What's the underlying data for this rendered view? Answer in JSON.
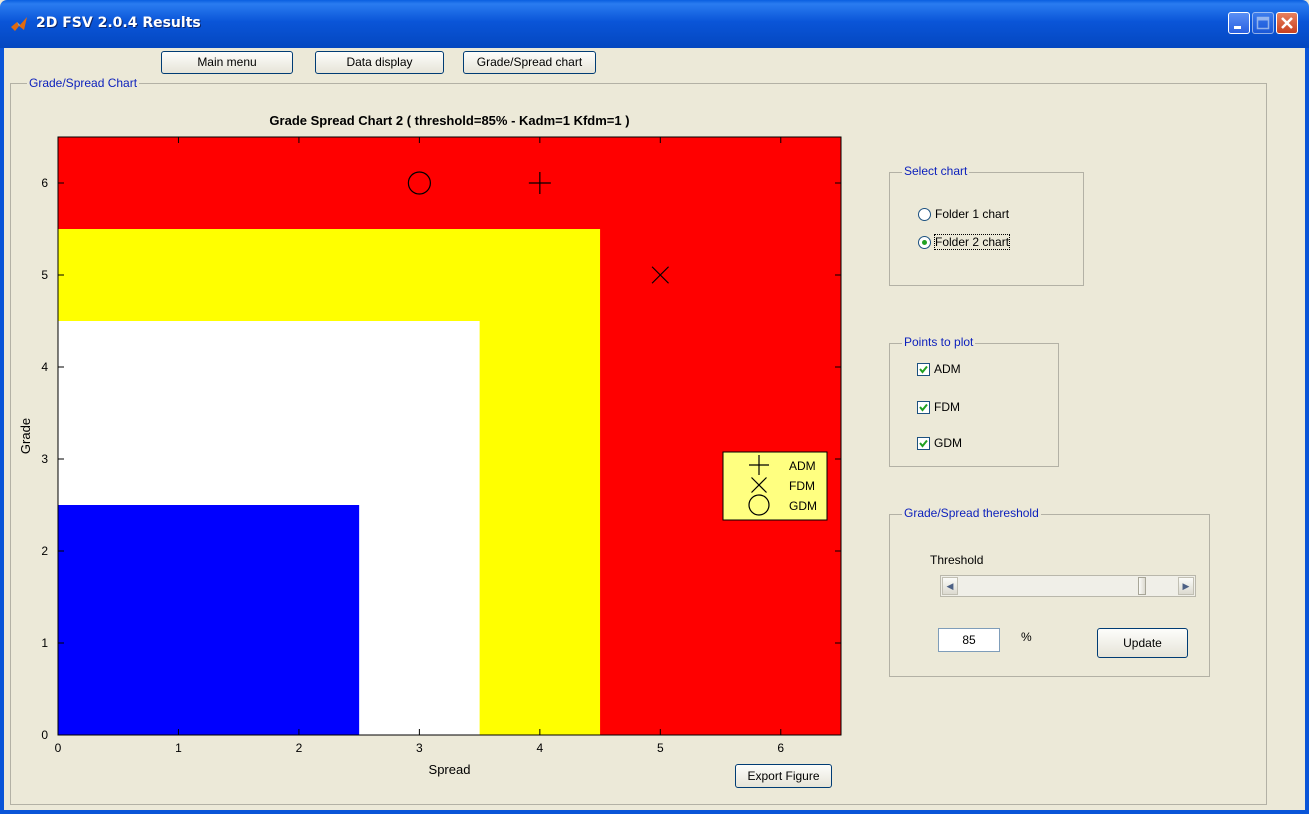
{
  "window": {
    "title": "2D FSV 2.0.4 Results",
    "icon": "matlab-logo-icon"
  },
  "toolbar": {
    "main_menu": "Main menu",
    "data_display": "Data display",
    "grade_spread_chart": "Grade/Spread chart"
  },
  "panel": {
    "title": "Grade/Spread Chart"
  },
  "chart_data": {
    "type": "scatter",
    "title": "Grade Spread Chart 2 ( threshold=85% - Kadm=1  Kfdm=1 )",
    "xlabel": "Spread",
    "ylabel": "Grade",
    "xlim": [
      0,
      6.5
    ],
    "ylim": [
      0,
      6.5
    ],
    "xticks": [
      "0",
      "1",
      "2",
      "3",
      "4",
      "5",
      "6"
    ],
    "yticks": [
      "0",
      "1",
      "2",
      "3",
      "4",
      "5",
      "6"
    ],
    "grid": false,
    "regions": [
      {
        "color": "#ff0000",
        "x": [
          0,
          6.5
        ],
        "y": [
          0,
          6.5
        ]
      },
      {
        "color": "#ffff00",
        "x": [
          0,
          4.5
        ],
        "y": [
          0,
          5.5
        ]
      },
      {
        "color": "#ffffff",
        "x": [
          0,
          3.5
        ],
        "y": [
          0,
          4.5
        ]
      },
      {
        "color": "#0000ff",
        "x": [
          0,
          2.5
        ],
        "y": [
          0,
          2.5
        ]
      }
    ],
    "series": [
      {
        "name": "ADM",
        "marker": "+",
        "x": [
          4
        ],
        "y": [
          6
        ]
      },
      {
        "name": "FDM",
        "marker": "x",
        "x": [
          5
        ],
        "y": [
          5
        ]
      },
      {
        "name": "GDM",
        "marker": "o",
        "x": [
          3
        ],
        "y": [
          6
        ]
      }
    ],
    "legend_position": "right"
  },
  "export_button": "Export Figure",
  "select_chart": {
    "title": "Select chart",
    "options": [
      "Folder 1 chart",
      "Folder 2 chart"
    ],
    "selected_index": 1
  },
  "points_to_plot": {
    "title": "Points to plot",
    "items": [
      {
        "label": "ADM",
        "checked": true
      },
      {
        "label": "FDM",
        "checked": true
      },
      {
        "label": "GDM",
        "checked": true
      }
    ]
  },
  "threshold": {
    "title": "Grade/Spread thereshold",
    "label": "Threshold",
    "value": "85",
    "unit": "%",
    "slider_fraction": 0.85,
    "update_button": "Update"
  },
  "colors": {
    "title_bar": "#0a55d8",
    "group_title": "#0b1fbc",
    "legend_background": "#ffff80"
  }
}
